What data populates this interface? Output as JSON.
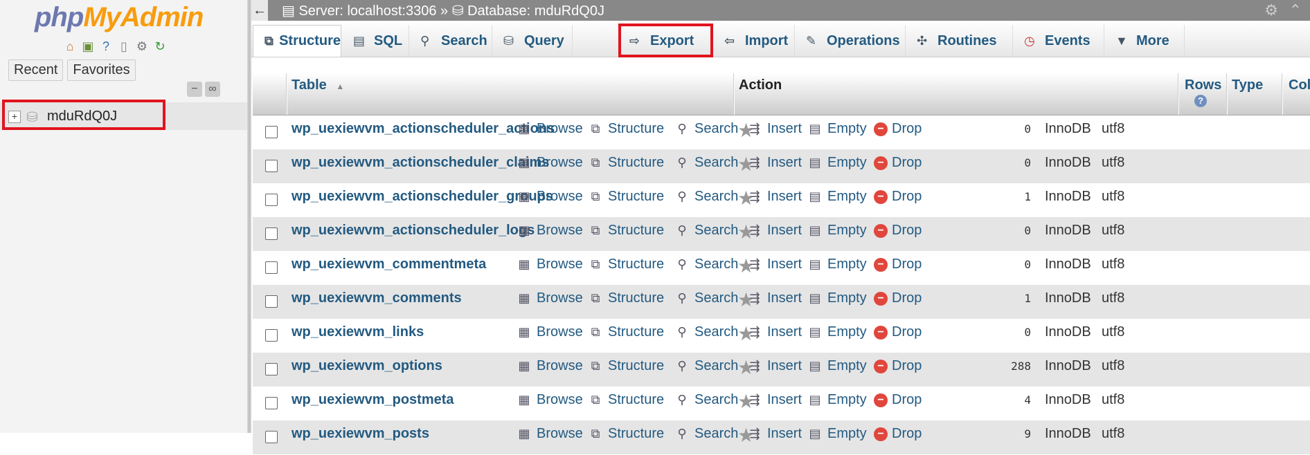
{
  "nav": {
    "logo_php": "php",
    "logo_my": "MyAdmin",
    "tabs": [
      "Recent",
      "Favorites"
    ],
    "db_name": "mduRdQ0J",
    "icons": [
      "home-icon",
      "exit-icon",
      "help-icon",
      "docs-icon",
      "settings-icon",
      "reload-icon"
    ]
  },
  "topbar": {
    "server": "Server: localhost:3306",
    "sep": "»",
    "database": "Database: mduRdQ0J"
  },
  "tabs": [
    {
      "label": "Structure",
      "icon": "structure-icon"
    },
    {
      "label": "SQL",
      "icon": "sql-icon"
    },
    {
      "label": "Search",
      "icon": "search-icon"
    },
    {
      "label": "Query",
      "icon": "query-icon"
    },
    {
      "label": "Export",
      "icon": "export-icon"
    },
    {
      "label": "Import",
      "icon": "import-icon"
    },
    {
      "label": "Operations",
      "icon": "wrench-icon"
    },
    {
      "label": "Routines",
      "icon": "routines-icon"
    },
    {
      "label": "Events",
      "icon": "clock-icon"
    },
    {
      "label": "More",
      "icon": "chevron-down-icon"
    }
  ],
  "table": {
    "headers": {
      "table": "Table",
      "action": "Action",
      "rows": "Rows",
      "type": "Type",
      "col": "Col"
    },
    "actions": [
      "Browse",
      "Structure",
      "Search",
      "Insert",
      "Empty",
      "Drop"
    ],
    "rows": [
      {
        "name": "wp_uexiewvm_actionscheduler_actions",
        "rows": "0",
        "type": "InnoDB",
        "col": "utf8"
      },
      {
        "name": "wp_uexiewvm_actionscheduler_claims",
        "rows": "0",
        "type": "InnoDB",
        "col": "utf8"
      },
      {
        "name": "wp_uexiewvm_actionscheduler_groups",
        "rows": "1",
        "type": "InnoDB",
        "col": "utf8"
      },
      {
        "name": "wp_uexiewvm_actionscheduler_logs",
        "rows": "0",
        "type": "InnoDB",
        "col": "utf8"
      },
      {
        "name": "wp_uexiewvm_commentmeta",
        "rows": "0",
        "type": "InnoDB",
        "col": "utf8"
      },
      {
        "name": "wp_uexiewvm_comments",
        "rows": "1",
        "type": "InnoDB",
        "col": "utf8"
      },
      {
        "name": "wp_uexiewvm_links",
        "rows": "0",
        "type": "InnoDB",
        "col": "utf8"
      },
      {
        "name": "wp_uexiewvm_options",
        "rows": "288",
        "type": "InnoDB",
        "col": "utf8"
      },
      {
        "name": "wp_uexiewvm_postmeta",
        "rows": "4",
        "type": "InnoDB",
        "col": "utf8"
      },
      {
        "name": "wp_uexiewvm_posts",
        "rows": "9",
        "type": "InnoDB",
        "col": "utf8"
      }
    ]
  }
}
